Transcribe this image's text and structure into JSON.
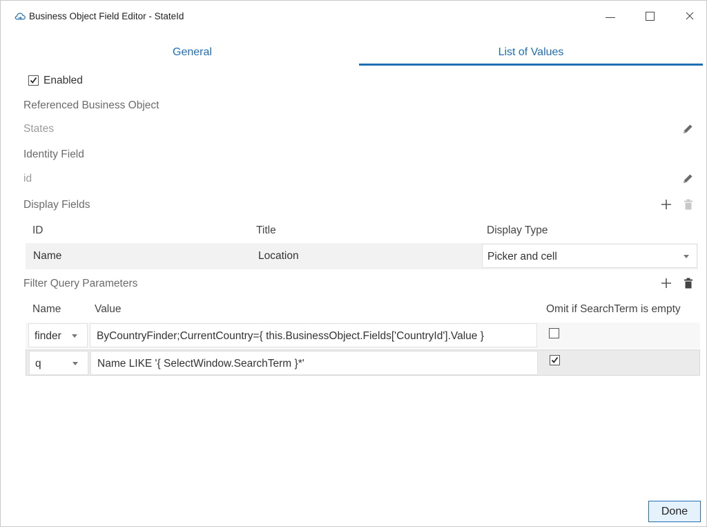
{
  "window": {
    "title": "Business Object Field Editor - StateId",
    "controls": {
      "minimize": "minimize",
      "maximize": "maximize",
      "close": "close"
    }
  },
  "tabs": [
    {
      "label": "General",
      "active": false
    },
    {
      "label": "List of Values",
      "active": true
    }
  ],
  "enabled": {
    "label": "Enabled",
    "checked": true
  },
  "referenced_business_object": {
    "label": "Referenced Business Object",
    "value": "States"
  },
  "identity_field": {
    "label": "Identity Field",
    "value": "id"
  },
  "display_fields": {
    "label": "Display Fields",
    "columns": [
      "ID",
      "Title",
      "Display Type"
    ],
    "rows": [
      {
        "id": "Name",
        "title": "Location",
        "display_type": "Picker and cell"
      }
    ]
  },
  "filter_query_parameters": {
    "label": "Filter Query Parameters",
    "columns": [
      "Name",
      "Value",
      "Omit if SearchTerm is empty"
    ],
    "rows": [
      {
        "name": "finder",
        "value": "ByCountryFinder;CurrentCountry={ this.BusinessObject.Fields['CountryId'].Value }",
        "omit": false
      },
      {
        "name": "q",
        "value": "Name LIKE '{ SelectWindow.SearchTerm }*'",
        "omit": true
      }
    ]
  },
  "buttons": {
    "done": "Done"
  },
  "colors": {
    "accent": "#1f6fb5",
    "text": "#333333",
    "muted": "#9b9b9b"
  }
}
